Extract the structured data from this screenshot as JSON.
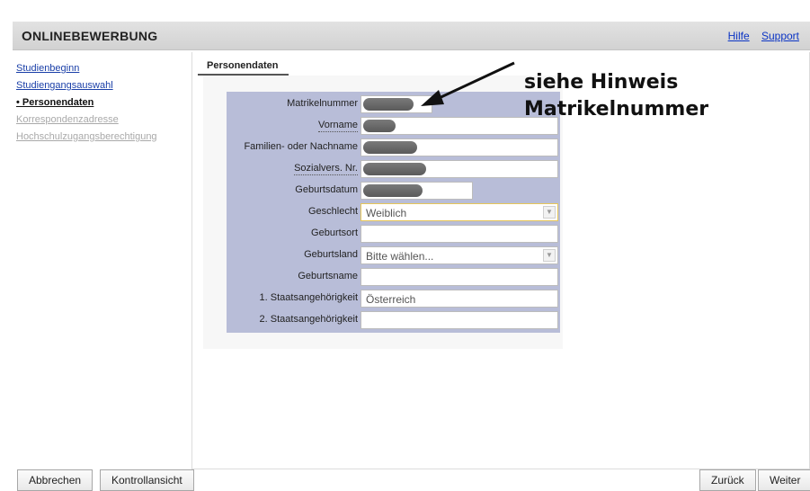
{
  "header": {
    "title": "Onlinebewerbung",
    "links": [
      "Hilfe",
      "Support"
    ]
  },
  "sidebar": {
    "items": [
      {
        "label": "Studienbeginn",
        "state": "link"
      },
      {
        "label": "Studiengangsauswahl",
        "state": "link"
      },
      {
        "label": "• Personendaten",
        "state": "active"
      },
      {
        "label": "Korrespondenzadresse",
        "state": "disabled"
      },
      {
        "label": "Hochschulzugangsberechtigung",
        "state": "disabled"
      }
    ]
  },
  "section": {
    "tab": "Personendaten"
  },
  "form": {
    "fields": [
      {
        "label": "Matrikelnummer",
        "value": "",
        "redacted": true
      },
      {
        "label": "Vorname",
        "value": "",
        "redacted": true
      },
      {
        "label": "Familien- oder Nachname",
        "value": "",
        "redacted": true
      },
      {
        "label": "Sozialvers. Nr.",
        "value": "",
        "redacted": true
      },
      {
        "label": "Geburtsdatum",
        "value": "",
        "redacted": true
      },
      {
        "label": "Geschlecht",
        "value": "Weiblich",
        "type": "select"
      },
      {
        "label": "Geburtsort",
        "value": ""
      },
      {
        "label": "Geburtsland",
        "value": "Bitte wählen...",
        "type": "select"
      },
      {
        "label": "Geburtsname",
        "value": ""
      },
      {
        "label": "1. Staatsangehörigkeit",
        "value": "Österreich"
      },
      {
        "label": "2. Staatsangehörigkeit",
        "value": ""
      }
    ]
  },
  "annotation": {
    "line1": "siehe Hinweis",
    "line2": "Matrikelnummer"
  },
  "footer": {
    "cancel": "Abbrechen",
    "review": "Kontrollansicht",
    "back": "Zurück",
    "next": "Weiter"
  }
}
